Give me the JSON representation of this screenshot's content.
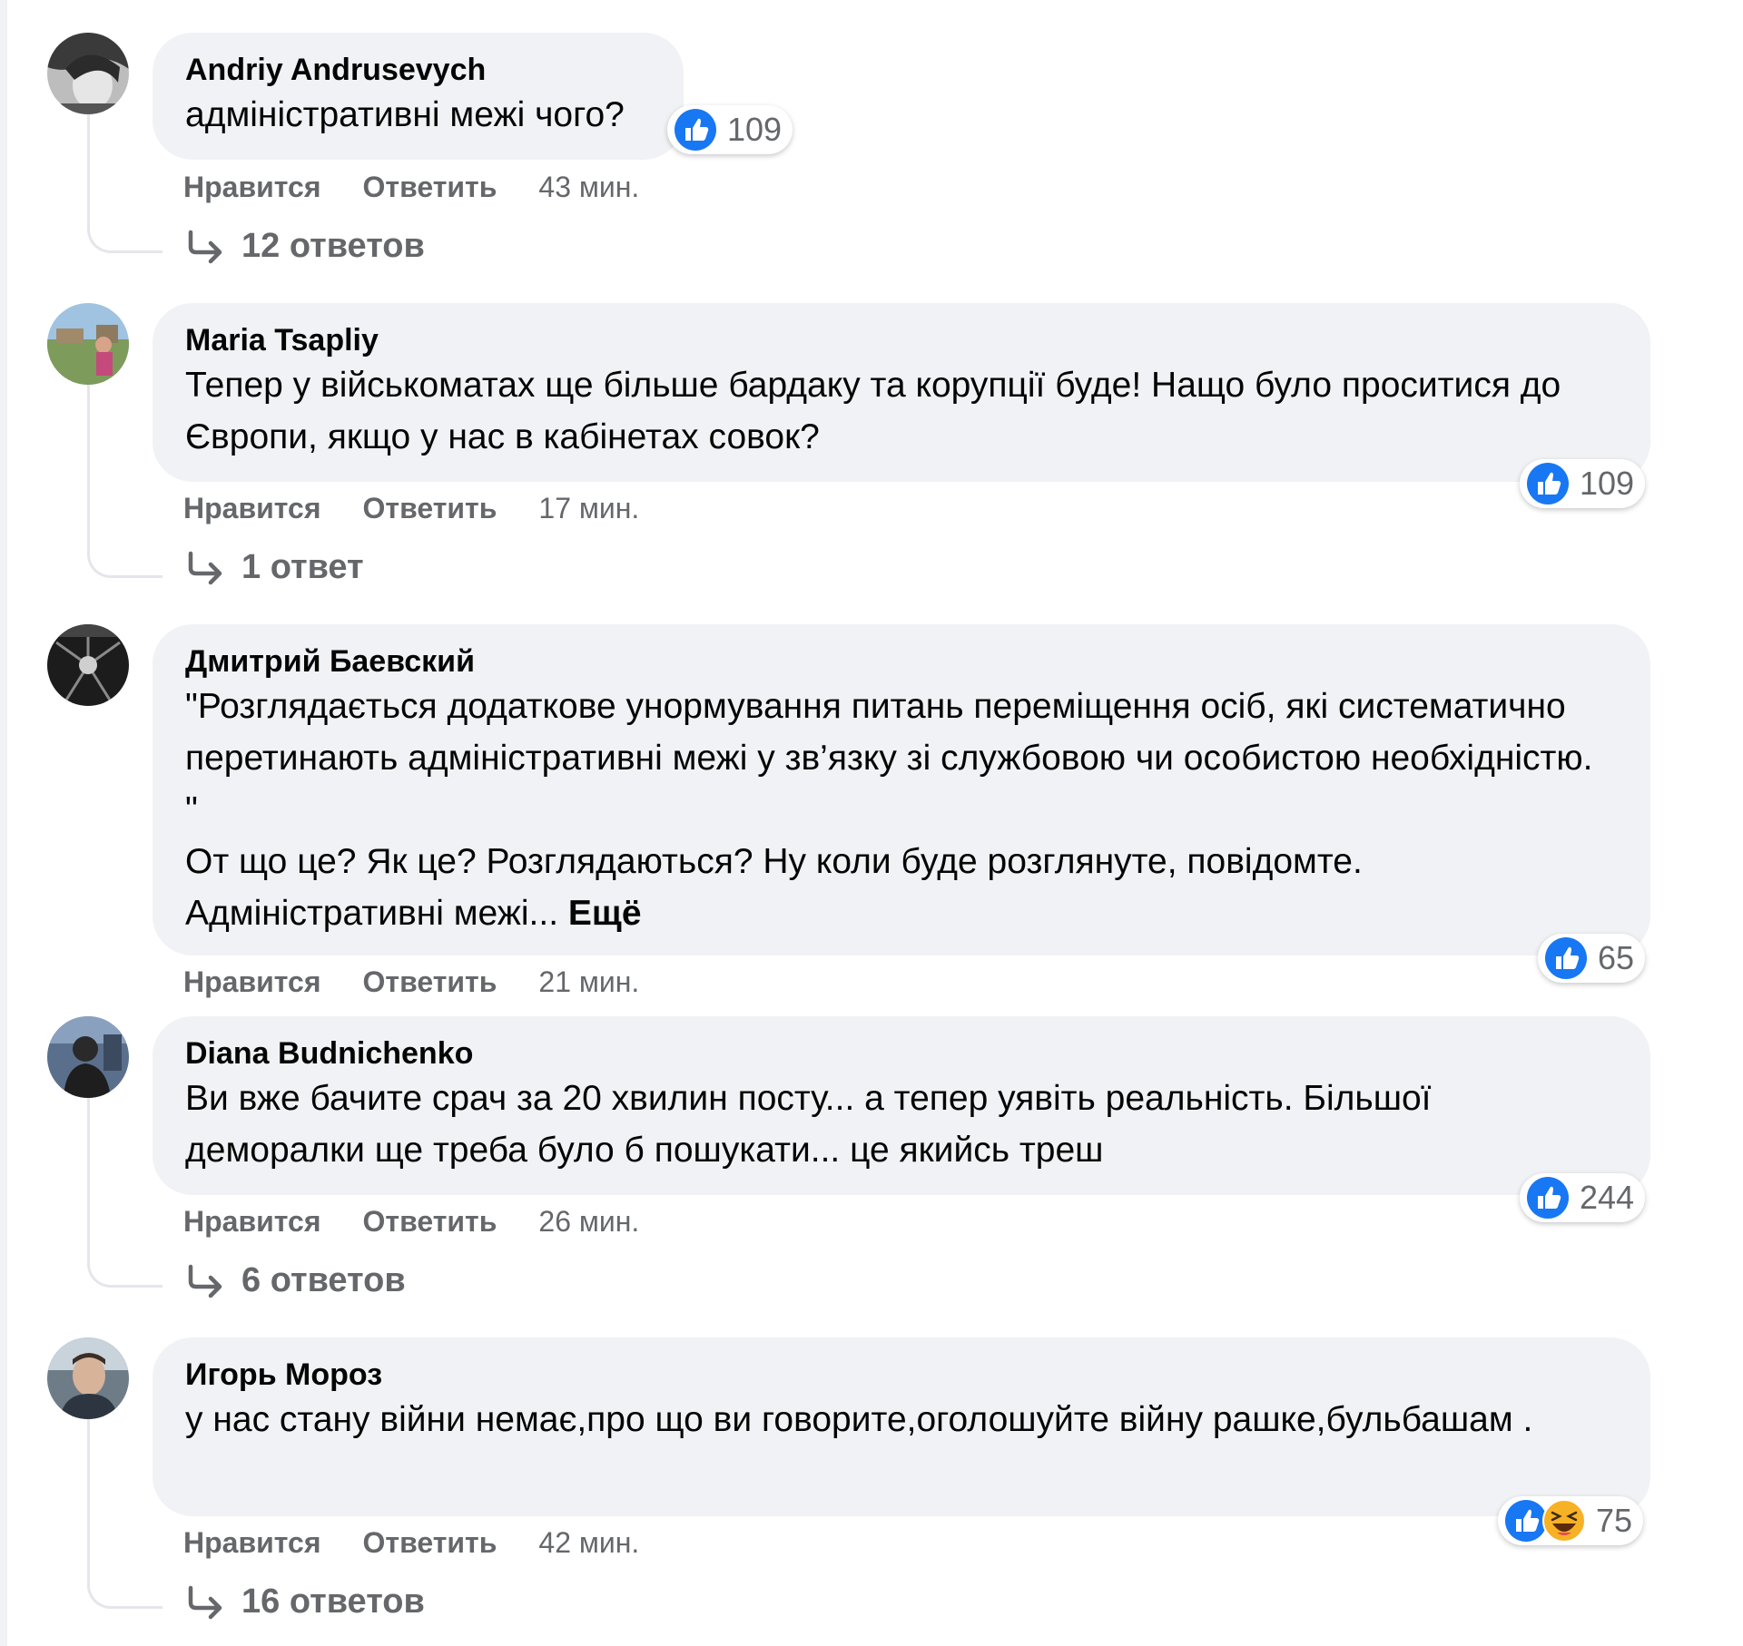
{
  "colors": {
    "bubble": "#f0f2f5",
    "like_blue": "#1877f2",
    "muted_text": "#65676b",
    "haha_yellow": "#f7b125"
  },
  "comments": [
    {
      "author": "Andriy Andrusevych",
      "text": "адміністративні межі чого?",
      "reaction_count": "109",
      "reactions": [
        "like-icon"
      ],
      "like_label": "Нравится",
      "reply_label": "Ответить",
      "time": "43 мин.",
      "replies": "12 ответов"
    },
    {
      "author": "Maria Tsapliy",
      "text": "Тепер у військоматах ще більше бардаку та корупції буде! Нащо було проситися до Європи, якщо у нас в кабінетах совок?",
      "reaction_count": "109",
      "reactions": [
        "like-icon"
      ],
      "like_label": "Нравится",
      "reply_label": "Ответить",
      "time": "17 мин.",
      "replies": "1 ответ"
    },
    {
      "author": "Дмитрий Баевский",
      "text": "\"Розглядається додаткове унормування питань переміщення осіб, які систематично перетинають адміністративні межі у зв’язку зі службовою чи особистою необхідністю. \"",
      "text_2": "От що це? Як це? Розглядаються? Ну коли буде розглянуте, повідомте.",
      "text_3": "Адміністративні межі...",
      "more_label": "Ещё",
      "reaction_count": "65",
      "reactions": [
        "like-icon"
      ],
      "like_label": "Нравится",
      "reply_label": "Ответить",
      "time": "21 мин."
    },
    {
      "author": "Diana Budnichenko",
      "text": "Ви вже бачите срач за 20 хвилин посту... а тепер уявіть реальність. Більшої деморалки ще треба було б пошукати... це якийсь треш",
      "reaction_count": "244",
      "reactions": [
        "like-icon"
      ],
      "like_label": "Нравится",
      "reply_label": "Ответить",
      "time": "26 мин.",
      "replies": "6 ответов"
    },
    {
      "author": "Игорь Мороз",
      "text": "у нас стану війни немає,про що ви говорите,оголошуйте війну рашке,бульбашам .",
      "reaction_count": "75",
      "reactions": [
        "like-icon",
        "haha-icon"
      ],
      "like_label": "Нравится",
      "reply_label": "Ответить",
      "time": "42 мин.",
      "replies": "16 ответов"
    }
  ]
}
